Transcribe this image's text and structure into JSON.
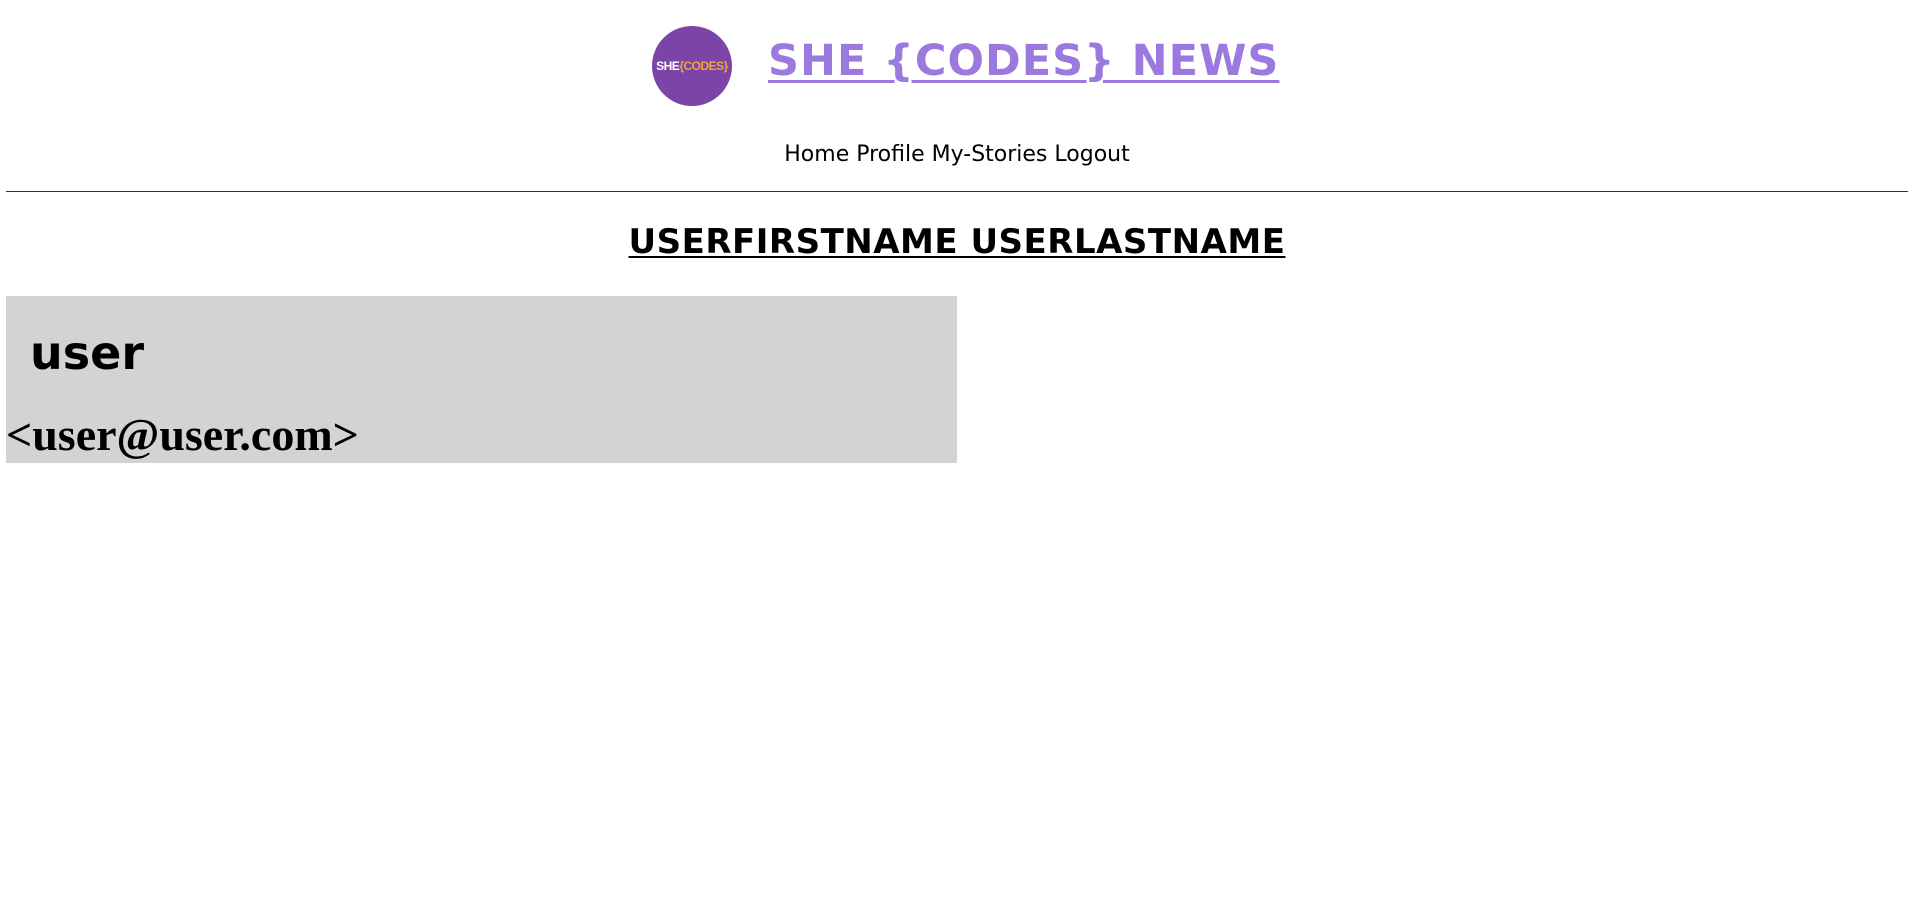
{
  "header": {
    "logo": {
      "text_she": "SHE",
      "text_codes": "{CODES}",
      "bg_color": "#7b44a6",
      "accent_color": "#f2a53a"
    },
    "title": "SHE {CODES} NEWS",
    "title_color": "#9b79de"
  },
  "nav": {
    "items": [
      {
        "label": "Home"
      },
      {
        "label": "Profile"
      },
      {
        "label": "My-Stories"
      },
      {
        "label": "Logout"
      }
    ]
  },
  "main": {
    "page_title": "USERFIRSTNAME USERLASTNAME",
    "profile": {
      "username": "user",
      "email": "<user@user.com>",
      "card_color": "#d3d3d3"
    }
  }
}
